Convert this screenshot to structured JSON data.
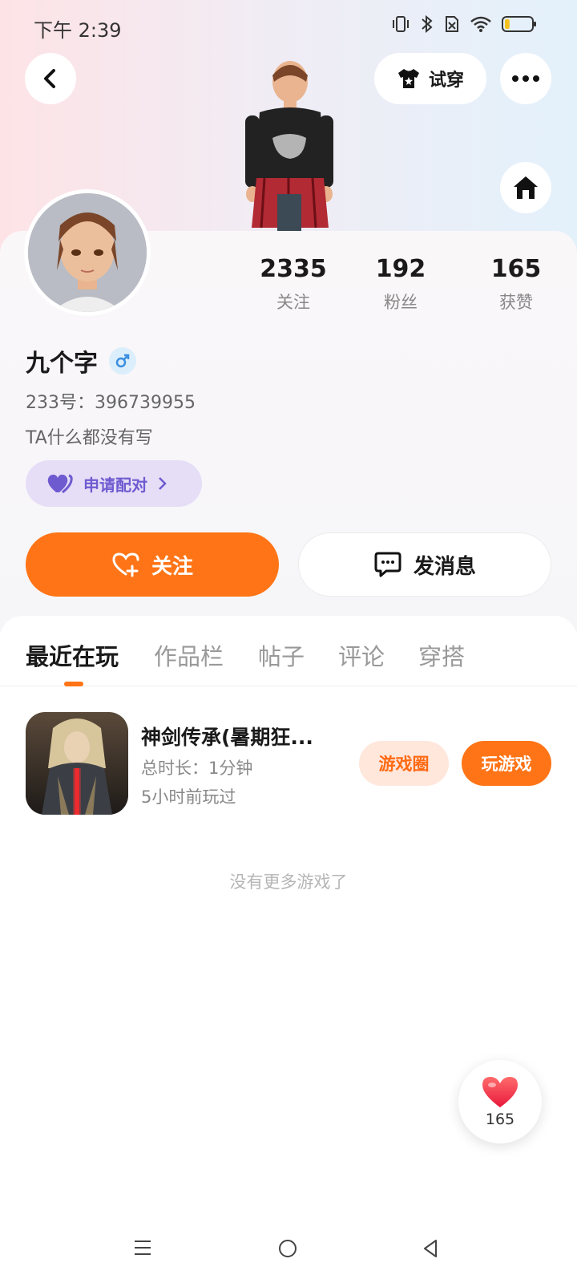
{
  "status": {
    "time": "下午 2:39",
    "battery_level": 0.18
  },
  "header": {
    "tryon_label": "试穿"
  },
  "stats": [
    {
      "value": "2335",
      "label": "关注"
    },
    {
      "value": "192",
      "label": "粉丝"
    },
    {
      "value": "165",
      "label": "获赞"
    }
  ],
  "profile": {
    "name": "九个字",
    "uid": "233号：396739955",
    "bio": "TA什么都没有写",
    "pair_label": "申请配对"
  },
  "actions": {
    "follow_label": "关注",
    "message_label": "发消息"
  },
  "tabs": [
    "最近在玩",
    "作品栏",
    "帖子",
    "评论",
    "穿搭"
  ],
  "game": {
    "title": "神剑传承(暑期狂...",
    "duration": "总时长：1分钟",
    "last_played": "5小时前玩过",
    "circle_label": "游戏圈",
    "play_label": "玩游戏"
  },
  "no_more": "没有更多游戏了",
  "likes": "165",
  "colors": {
    "accent": "#ff7416",
    "pair": "#6f5bd0"
  }
}
